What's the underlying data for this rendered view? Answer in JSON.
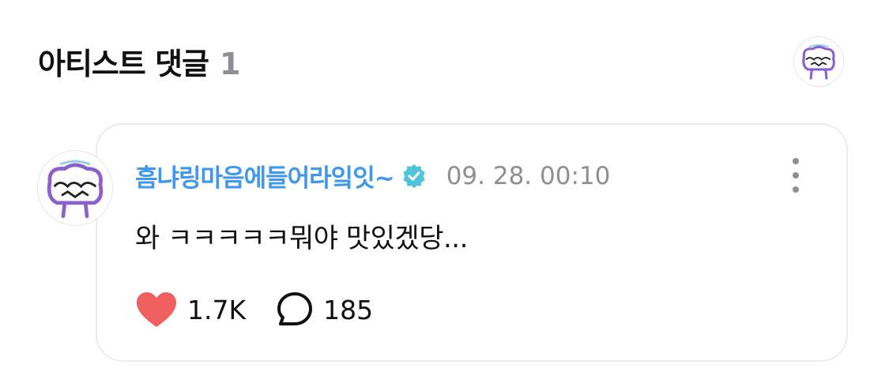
{
  "section": {
    "title": "아티스트 댓글",
    "count": "1"
  },
  "comment": {
    "author": "흠냐링마음에들어라잌잇~",
    "verified_icon": "verified-badge-icon",
    "timestamp": "09. 28. 00:10",
    "text": "와 ㅋㅋㅋㅋㅋ뭐야 맛있겠당...",
    "likes": "1.7K",
    "replies": "185",
    "more_icon": "more-vertical-icon"
  },
  "colors": {
    "author": "#3f98ee",
    "verified": "#4fc3d9",
    "heart": "#ef5f5f",
    "muted": "#8e8e93",
    "avatar_stroke": "#8a5fd0"
  }
}
